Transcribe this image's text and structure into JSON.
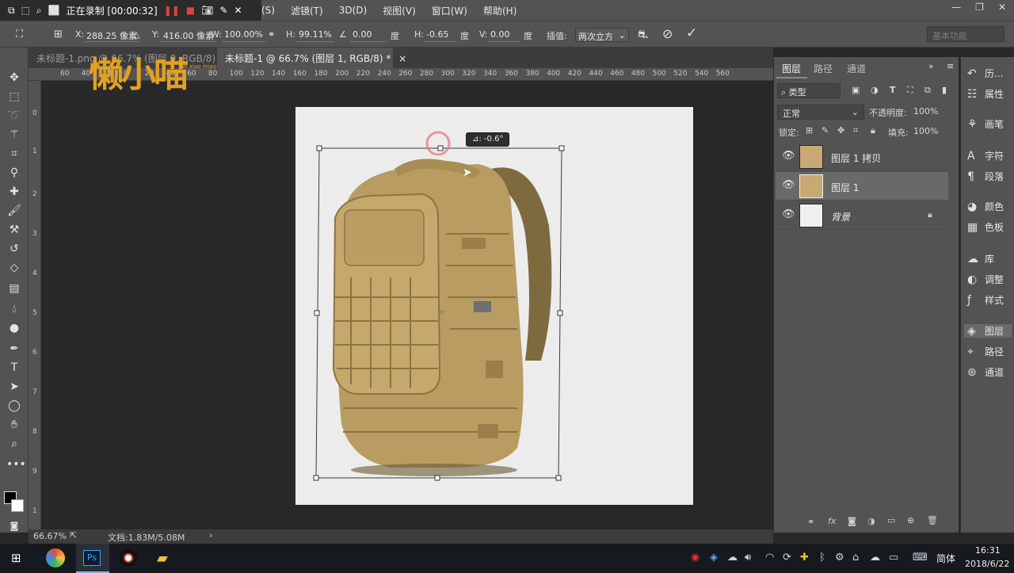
{
  "recording": {
    "status": "正在录制 [00:00:32]"
  },
  "menu": {
    "items": [
      "(S)",
      "滤镜(T)",
      "3D(D)",
      "视图(V)",
      "窗口(W)",
      "帮助(H)"
    ]
  },
  "options": {
    "x_label": "X:",
    "x_value": "288.25 像素",
    "y_label": "Y:",
    "y_value": "416.00 像素",
    "w_label": "W:",
    "w_value": "100.00%",
    "h_label": "H:",
    "h_value": "99.11%",
    "angle_value": "0.00",
    "angle_unit": "度",
    "hskew_label": "H:",
    "hskew_value": "-0.65",
    "hskew_unit": "度",
    "vskew_label": "V:",
    "vskew_value": "0.00",
    "vskew_unit": "度",
    "interp_label": "插值:",
    "interp_value": "两次立方",
    "workspace": "基本功能"
  },
  "tabs": [
    {
      "label": "未标题-1.png @ 66.7% (图层 0, RGB/8)",
      "close": "×"
    },
    {
      "label": "未标题-1 @ 66.7% (图层 1, RGB/8) *",
      "close": "×"
    }
  ],
  "ruler": {
    "top": [
      "60",
      "40",
      "20",
      "0",
      "20",
      "40",
      "60",
      "80",
      "100",
      "120",
      "140",
      "160",
      "180",
      "200",
      "220",
      "240",
      "260",
      "280",
      "300",
      "320",
      "340",
      "360",
      "380",
      "400",
      "420",
      "440",
      "460",
      "480",
      "500",
      "520",
      "540",
      "560"
    ]
  },
  "watermark": {
    "main": "懒小喵",
    "sub": "lan xiao miao"
  },
  "canvas": {
    "rotation_tooltip": "⊿: -0.6°"
  },
  "status": {
    "zoom": "66.67%",
    "doc": "文档:1.83M/5.08M"
  },
  "layers_panel": {
    "tabs": [
      "图层",
      "路径",
      "通道"
    ],
    "filter_label": "类型",
    "blend_mode": "正常",
    "opacity_label": "不透明度:",
    "opacity_value": "100%",
    "lock_label": "锁定:",
    "fill_label": "填充:",
    "fill_value": "100%",
    "layers": [
      {
        "name": "图层 1 拷贝"
      },
      {
        "name": "图层 1"
      },
      {
        "name": "背景"
      }
    ]
  },
  "dock": {
    "items": [
      "历...",
      "属性",
      "画笔",
      "字符",
      "段落",
      "颜色",
      "色板",
      "库",
      "调整",
      "样式",
      "图层",
      "路径",
      "通道"
    ]
  },
  "taskbar": {
    "ime": "简体",
    "time": "16:31",
    "date": "2018/6/22"
  }
}
